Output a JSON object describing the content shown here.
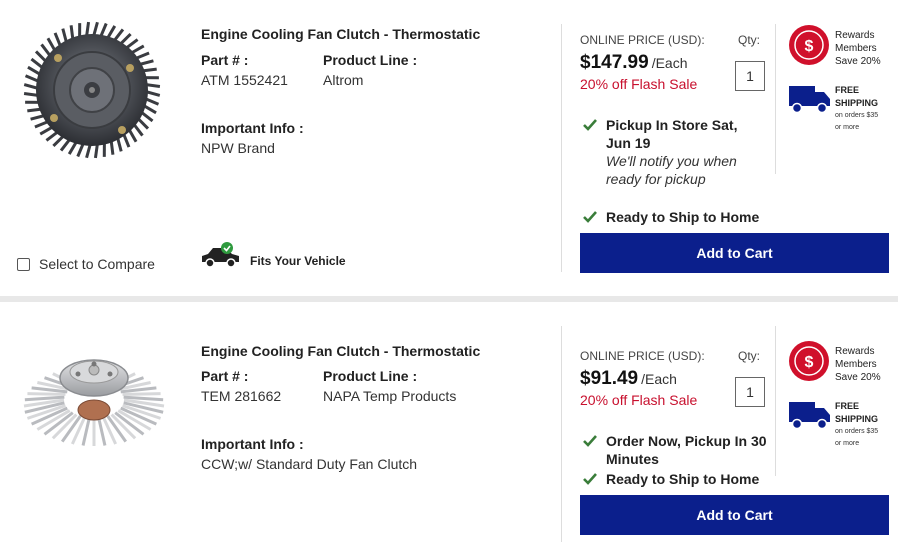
{
  "products": [
    {
      "title": "Engine Cooling Fan Clutch - Thermostatic",
      "part_label": "Part # :",
      "part_value": "ATM 1552421",
      "line_label": "Product Line :",
      "line_value": "Altrom",
      "info_label": "Important Info :",
      "info_value": "NPW Brand",
      "compare_label": "Select to Compare",
      "fits_label": "Fits Your Vehicle",
      "price_label": "ONLINE PRICE (USD):",
      "qty_label": "Qty:",
      "price": "$147.99",
      "each": "/Each",
      "flash": "20% off Flash Sale",
      "qty": "1",
      "pickup_title": "Pickup In Store Sat, Jun 19",
      "pickup_sub": "We'll notify you when ready for pickup",
      "ship_title": "Ready to Ship to Home",
      "add_to_cart": "Add to Cart"
    },
    {
      "title": "Engine Cooling Fan Clutch - Thermostatic",
      "part_label": "Part # :",
      "part_value": "TEM 281662",
      "line_label": "Product Line :",
      "line_value": "NAPA Temp Products",
      "info_label": "Important Info :",
      "info_value": "CCW;w/ Standard Duty Fan Clutch",
      "price_label": "ONLINE PRICE (USD):",
      "qty_label": "Qty:",
      "price": "$91.49",
      "each": "/Each",
      "flash": "20% off Flash Sale",
      "qty": "1",
      "pickup_title": "Order Now, Pickup In 30 Minutes",
      "ship_title": "Ready to Ship to Home",
      "add_to_cart": "Add to Cart"
    }
  ],
  "promo": {
    "rewards_badge": "$",
    "rewards_line1": "Rewards",
    "rewards_line2": "Members",
    "rewards_line3": "Save 20%",
    "free_line1": "FREE",
    "free_line2": "SHIPPING",
    "free_sub1": "on orders $35",
    "free_sub2": "or more"
  },
  "colors": {
    "brand_blue": "#0b1f8c",
    "sale_red": "#c8102e",
    "check_green": "#3a7d3a"
  }
}
